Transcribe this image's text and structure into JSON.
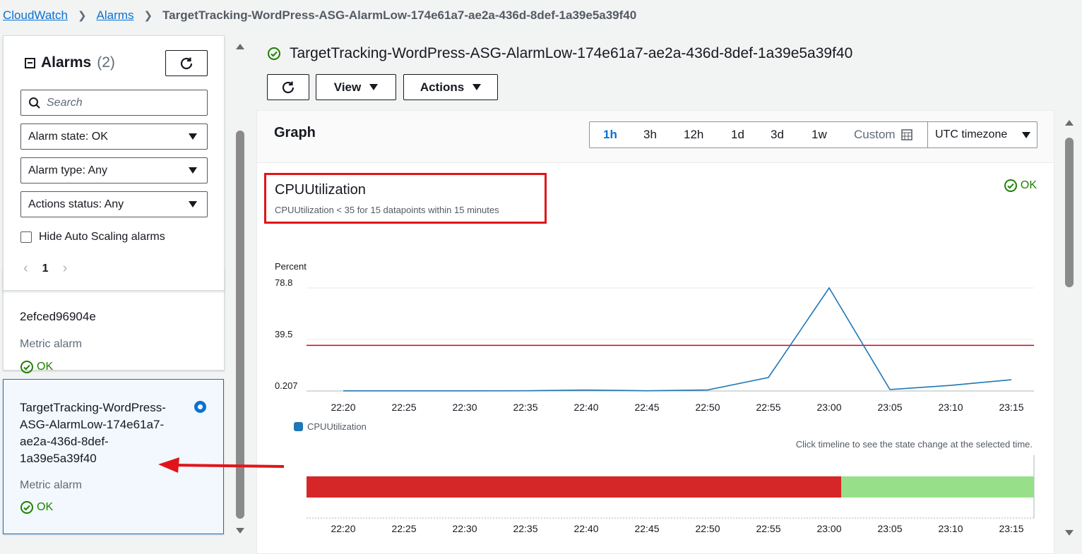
{
  "breadcrumb": {
    "items": [
      "CloudWatch",
      "Alarms"
    ],
    "current": "TargetTracking-WordPress-ASG-AlarmLow-174e61a7-ae2a-436d-8def-1a39e5a39f40"
  },
  "alarm_list": {
    "title": "Alarms",
    "count": "(2)",
    "search_placeholder": "Search",
    "filters": [
      "Alarm state: OK",
      "Alarm type: Any",
      "Actions status: Any"
    ],
    "hide_asg_label": "Hide Auto Scaling alarms",
    "page": "1",
    "items": [
      {
        "name_tail": "2efced96904e",
        "kind": "Metric alarm",
        "state": "OK"
      },
      {
        "name": "TargetTracking-WordPress-ASG-AlarmLow-174e61a7-ae2a-436d-8def-1a39e5a39f40",
        "name_lines": [
          "TargetTracking-WordPress-",
          "ASG-AlarmLow-174e61a7-",
          "ae2a-436d-8def-",
          "1a39e5a39f40"
        ],
        "kind": "Metric alarm",
        "state": "OK",
        "selected": true
      }
    ]
  },
  "detail": {
    "title": "TargetTracking-WordPress-ASG-AlarmLow-174e61a7-ae2a-436d-8def-1a39e5a39f40",
    "buttons": {
      "view": "View",
      "actions": "Actions"
    },
    "graph": {
      "heading": "Graph",
      "ranges": [
        "1h",
        "3h",
        "12h",
        "1d",
        "3d",
        "1w"
      ],
      "active_range": "1h",
      "custom_label": "Custom",
      "timezone": "UTC timezone",
      "metric_title": "CPUUtilization",
      "metric_desc": "CPUUtilization < 35 for 15 datapoints within 15 minutes",
      "state": "OK",
      "timeline_hint": "Click timeline to see the state change at the selected time."
    }
  },
  "colors": {
    "accent": "#0972d3",
    "ok": "#1d8102",
    "series": "#1f77b4",
    "threshold": "#d0021b",
    "alarm_state": "#d62728",
    "ok_state": "#98df8a"
  },
  "chart_data": {
    "type": "line",
    "ylabel": "Percent",
    "y_ticks": [
      "78.8",
      "39.5",
      "0.207"
    ],
    "ylim": [
      0.207,
      78.8
    ],
    "x_ticks": [
      "22:20",
      "22:25",
      "22:30",
      "22:35",
      "22:40",
      "22:45",
      "22:50",
      "22:55",
      "23:00",
      "23:05",
      "23:10",
      "23:15"
    ],
    "series": [
      {
        "name": "CPUUtilization",
        "x": [
          "22:20",
          "22:25",
          "22:30",
          "22:35",
          "22:40",
          "22:45",
          "22:50",
          "22:55",
          "23:00",
          "23:05",
          "23:10",
          "23:15"
        ],
        "values": [
          0.3,
          0.3,
          0.3,
          0.4,
          0.9,
          0.4,
          1.0,
          10.5,
          78.8,
          1.3,
          4.5,
          8.8
        ]
      }
    ],
    "threshold": 35,
    "legend": "bottom-left",
    "timeline": [
      {
        "state": "ALARM",
        "from": "22:20",
        "to": "23:01"
      },
      {
        "state": "OK",
        "from": "23:01",
        "to": "23:17"
      }
    ]
  }
}
